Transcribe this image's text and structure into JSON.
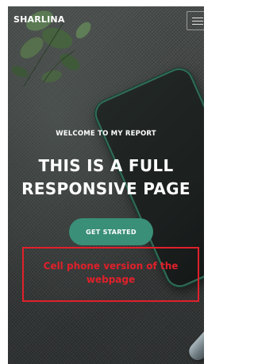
{
  "header": {
    "brand": "SHARLINA",
    "menu_icon": "hamburger-menu-icon"
  },
  "hero": {
    "subtitle": "WELCOME TO MY REPORT",
    "title_line1": "THIS IS A FULL",
    "title_line2": "RESPONSIVE PAGE",
    "cta_label": "GET STARTED"
  },
  "annotation": {
    "text": "Cell phone version of the webpage"
  },
  "colors": {
    "accent": "#3a8f78",
    "annotation": "#e0202a",
    "text": "#ffffff",
    "background": "#3a3d3c"
  }
}
